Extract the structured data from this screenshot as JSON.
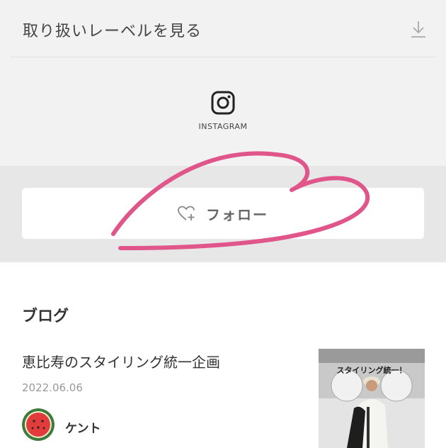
{
  "labels_row": {
    "text": "取り扱いレーベルを見る",
    "icon": "download-icon"
  },
  "instagram": {
    "label": "INSTAGRAM",
    "icon": "instagram-icon"
  },
  "follow": {
    "label": "フォロー",
    "icon": "heart-plus-icon"
  },
  "annotation": {
    "color": "#e0558a",
    "shape": "hand-drawn heart outline"
  },
  "blog": {
    "heading": "ブログ",
    "posts": [
      {
        "title": "恵比寿のスタイリング統一企画",
        "date": "2022.06.06",
        "author": "ケント",
        "thumbnail_caption": "スタイリング統一！"
      }
    ]
  }
}
